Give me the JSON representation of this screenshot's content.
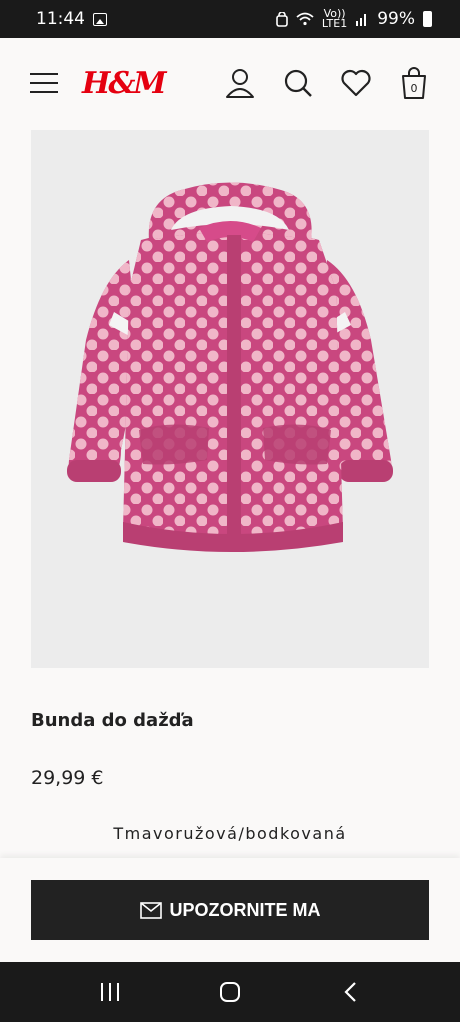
{
  "status_bar": {
    "time": "11:44",
    "network_top": "Vo))",
    "network_bottom": "LTE1",
    "battery": "99%"
  },
  "header": {
    "logo": "H&M",
    "bag_count": "0"
  },
  "product": {
    "title": "Bunda do dažďa",
    "price": "29,99 €",
    "color": "Tmavoružová/bodkovaná"
  },
  "actions": {
    "notify_label": "UPOZORNITE MA"
  },
  "icons": [
    "menu-icon",
    "account-icon",
    "search-icon",
    "heart-icon",
    "bag-icon",
    "mail-icon",
    "recent-apps-icon",
    "home-icon",
    "back-icon"
  ],
  "colors": {
    "brand_red": "#e50010",
    "jacket_pink": "#c9477f",
    "dot_pink": "#f0b6c8",
    "button_dark": "#222222"
  }
}
